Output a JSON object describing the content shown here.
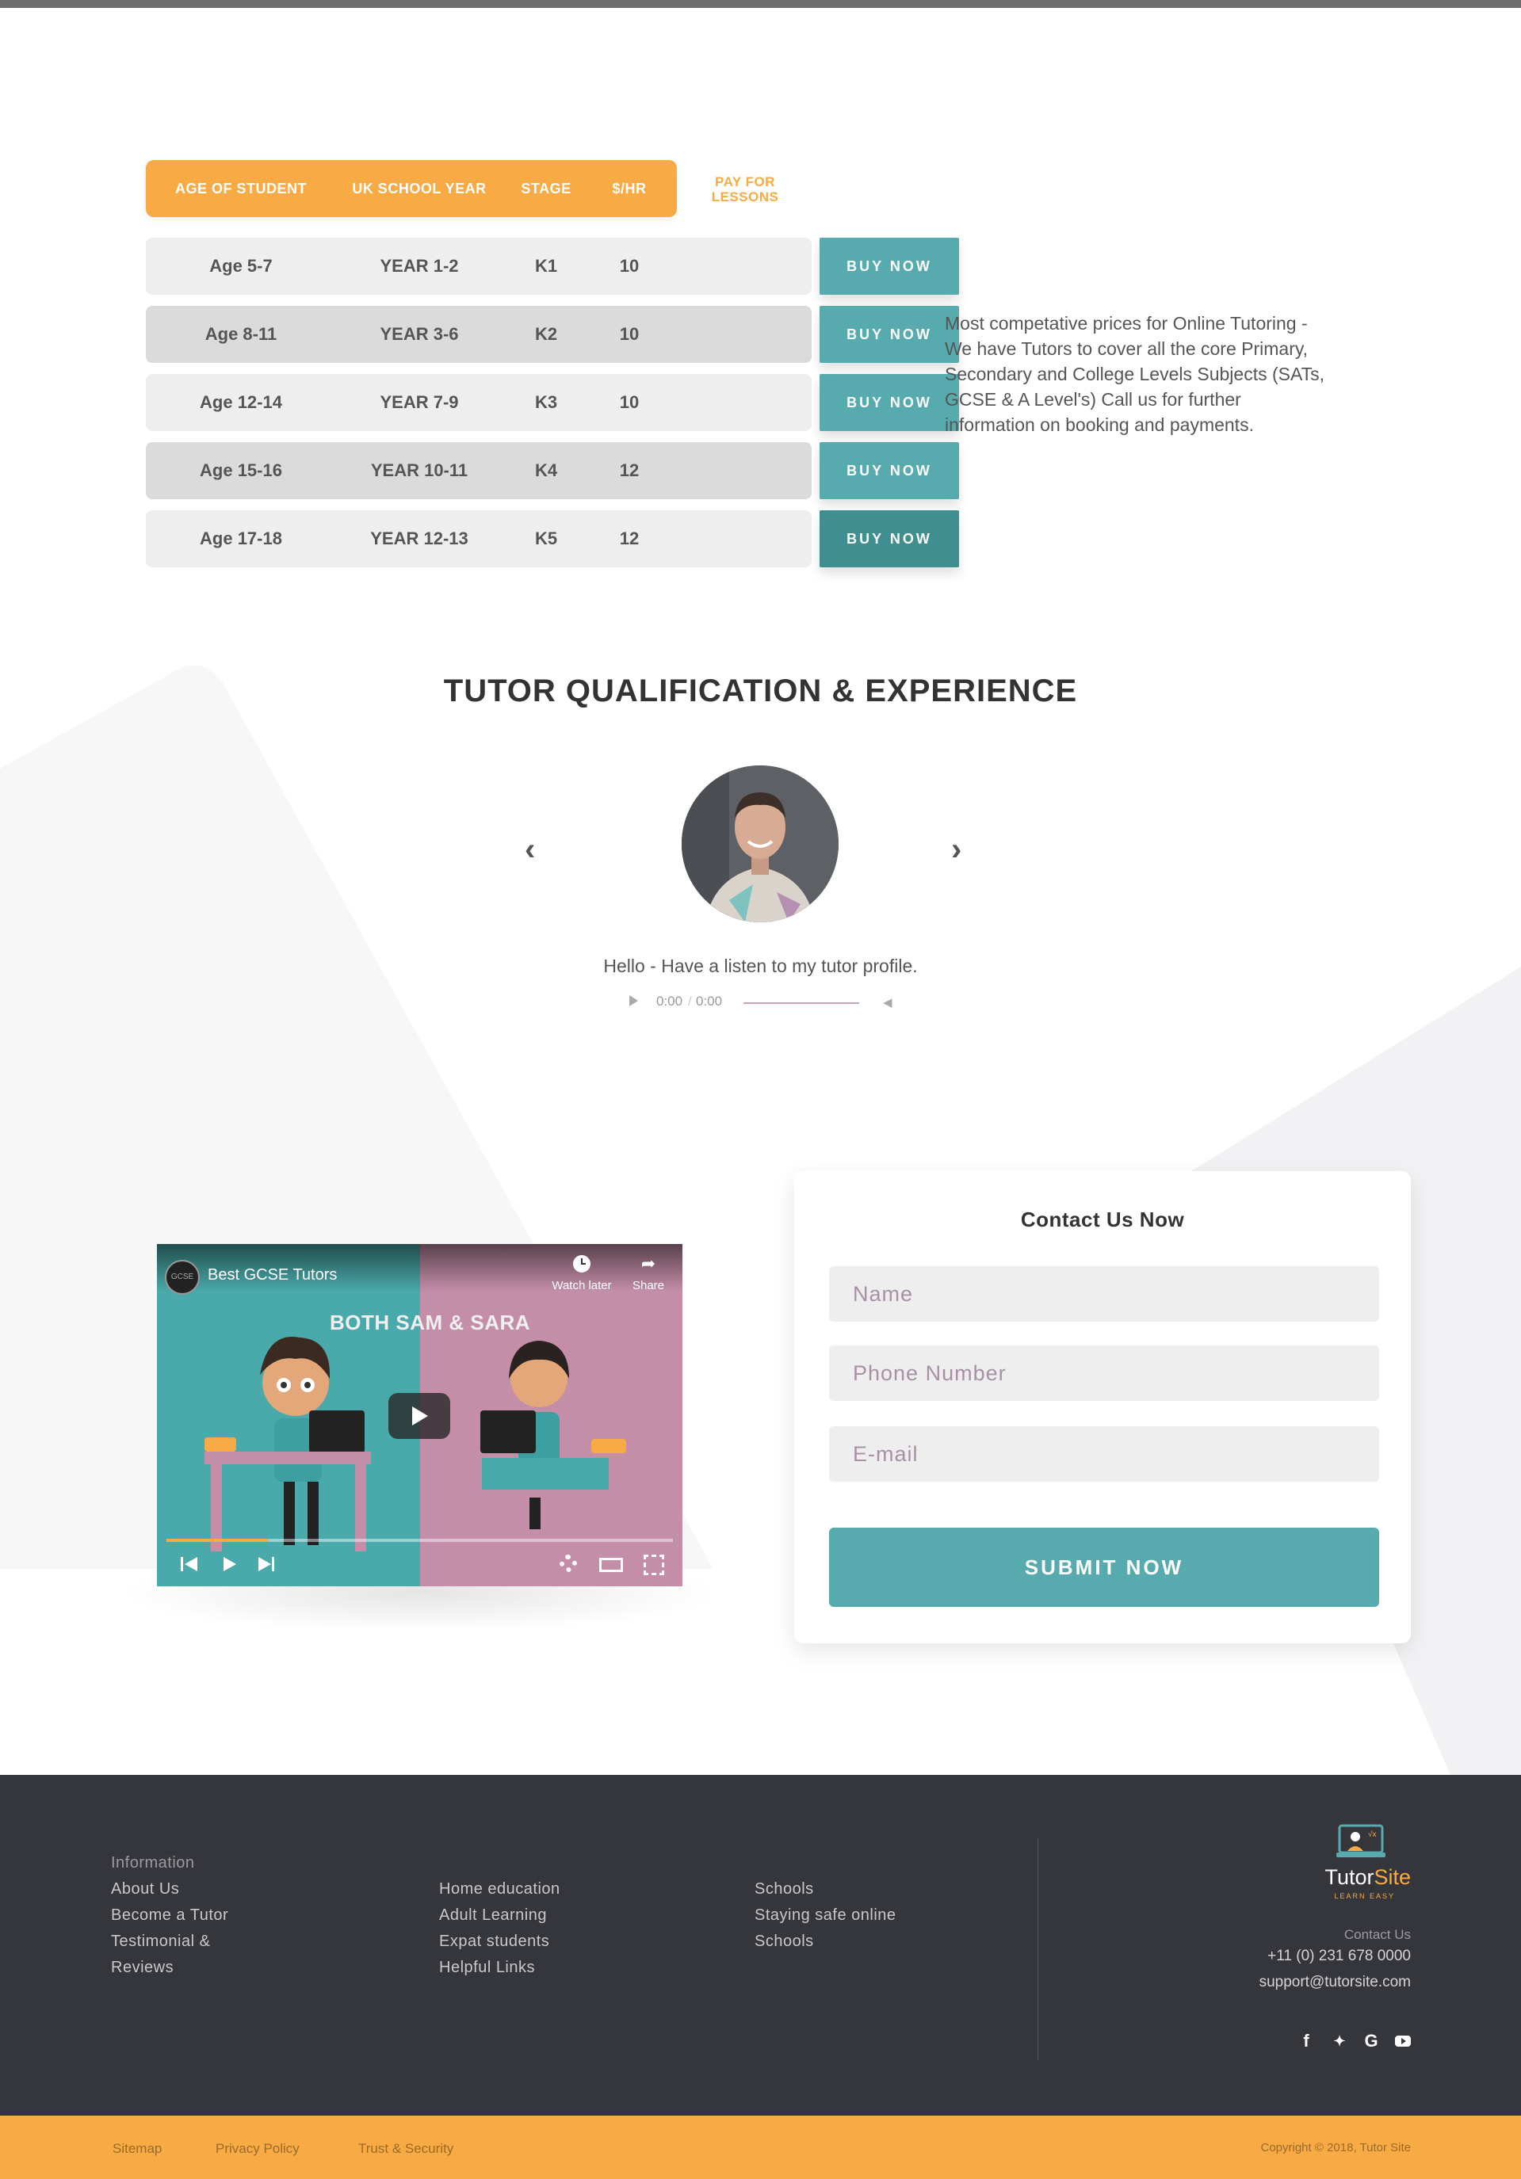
{
  "colors": {
    "accent": "#f8ab44",
    "teal": "#57aaad",
    "footer_bg": "#35363b"
  },
  "pricing": {
    "headers": [
      "AGE OF STUDENT",
      "UK SCHOOL YEAR",
      "STAGE",
      "$/HR"
    ],
    "pay_label": "PAY FOR LESSONS",
    "rows": [
      {
        "age": "Age 5-7",
        "year": "YEAR 1-2",
        "stage": "K1",
        "rate": "10",
        "button": "BUY NOW"
      },
      {
        "age": "Age 8-11",
        "year": "YEAR 3-6",
        "stage": "K2",
        "rate": "10",
        "button": "BUY NOW"
      },
      {
        "age": "Age 12-14",
        "year": "YEAR 7-9",
        "stage": "K3",
        "rate": "10",
        "button": "BUY NOW"
      },
      {
        "age": "Age 15-16",
        "year": "YEAR 10-11",
        "stage": "K4",
        "rate": "12",
        "button": "BUY NOW"
      },
      {
        "age": "Age 17-18",
        "year": "YEAR 12-13",
        "stage": "K5",
        "rate": "12",
        "button": "BUY NOW"
      }
    ],
    "description": "Most competative prices for Online Tutoring - We have Tutors to cover all the core Primary, Secondary and College Levels Subjects (SATs, GCSE & A Level's) Call us for further information on booking and payments."
  },
  "tutor": {
    "title": "TUTOR QUALIFICATION & EXPERIENCE",
    "caption": "Hello - Have a listen to my tutor profile.",
    "audio_current": "0:00",
    "audio_total": "0:00",
    "prev_icon": "chevron-left-icon",
    "next_icon": "chevron-right-icon"
  },
  "video": {
    "channel_logo": "GCSE",
    "title": "Best GCSE Tutors",
    "subtitle": "BOTH SAM & SARA",
    "watch_later": "Watch later",
    "share": "Share",
    "progress": 0.2
  },
  "contact": {
    "title": "Contact Us Now",
    "name_placeholder": "Name",
    "phone_placeholder": "Phone Number",
    "email_placeholder": "E-mail",
    "submit": "SUBMIT NOW"
  },
  "footer": {
    "col1": [
      "Information",
      "About Us",
      "Become a Tutor",
      "Testimonial &",
      "Reviews"
    ],
    "col2": [
      "Home education",
      "Adult Learning",
      "Expat students",
      "Helpful Links"
    ],
    "col3": [
      "Schools",
      "Staying safe online",
      "Schools"
    ],
    "brand_main": "Tutor",
    "brand_accent": "Site",
    "brand_tag": "LEARN EASY",
    "contact_label": "Contact Us",
    "phone": "+11 (0) 231 678 0000",
    "email": "support@tutorsite.com",
    "social": [
      "facebook-icon",
      "twitter-icon",
      "google-icon",
      "youtube-icon"
    ]
  },
  "bottom": {
    "links": [
      "Sitemap",
      "Privacy Policy",
      "Trust & Security"
    ],
    "copyright": "Copyright © 2018, Tutor Site"
  }
}
